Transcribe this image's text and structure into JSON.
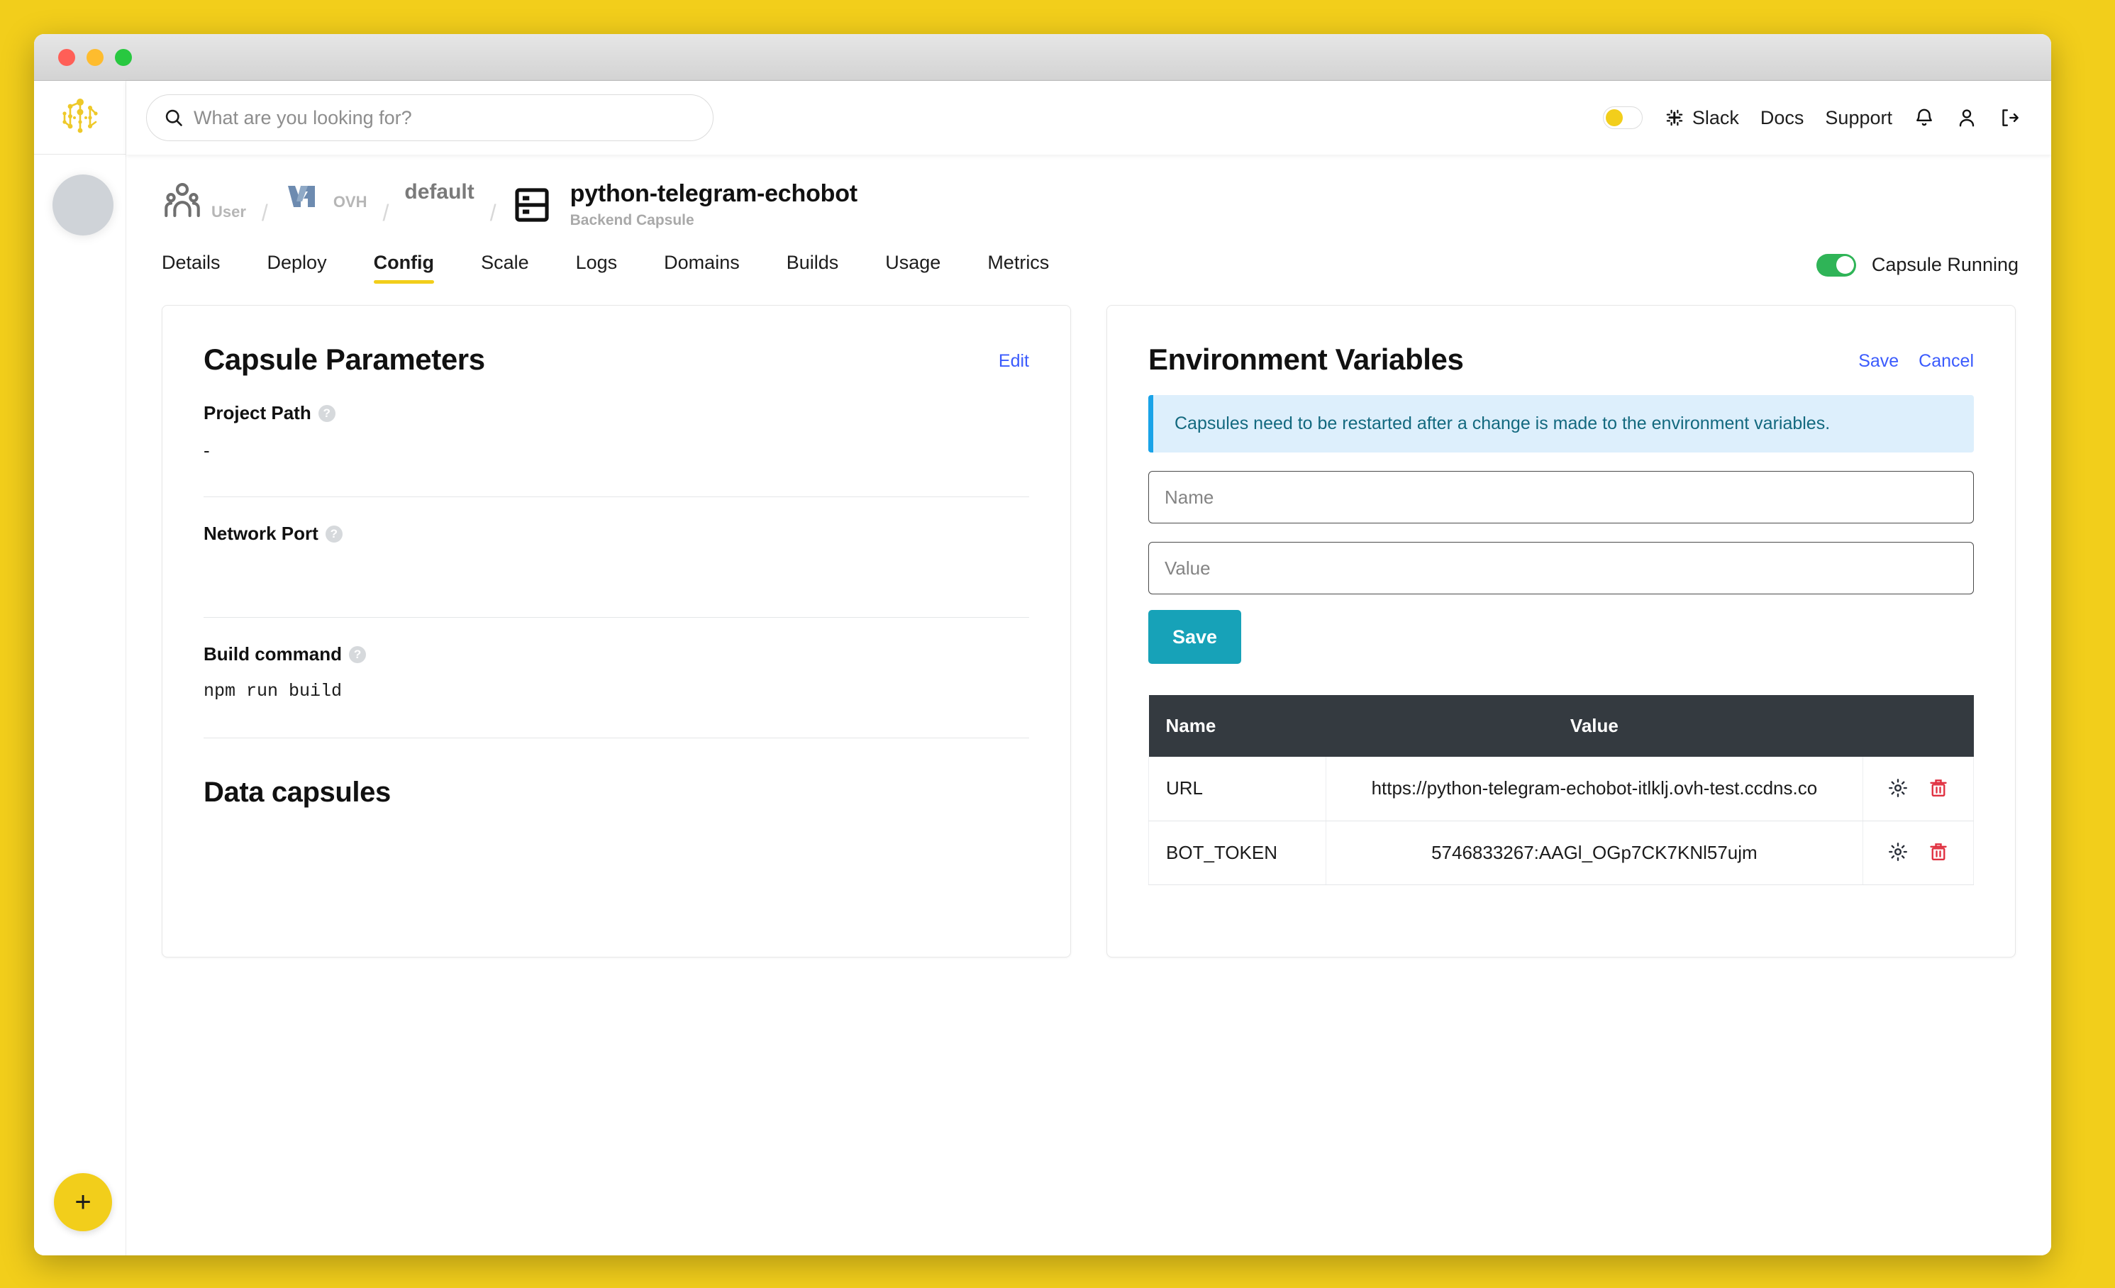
{
  "window": {
    "traffic_lights": [
      "close",
      "minimize",
      "zoom"
    ]
  },
  "sidebar": {
    "logo_name": "capsule-network-logo",
    "add_button_label": "+"
  },
  "search": {
    "placeholder": "What are you looking for?",
    "value": "",
    "icon": "search-icon"
  },
  "topbar": {
    "theme_toggle_state": "off",
    "links": [
      {
        "label": "Slack",
        "icon": "slack-icon"
      },
      {
        "label": "Docs",
        "icon": null
      },
      {
        "label": "Support",
        "icon": null
      }
    ],
    "icons": [
      {
        "name": "bell-icon"
      },
      {
        "name": "user-icon"
      },
      {
        "name": "logout-icon"
      }
    ]
  },
  "breadcrumb": {
    "items": [
      {
        "label": "User",
        "icon": "users-icon"
      },
      {
        "label": "OVH",
        "icon": "ovh-logo-icon"
      },
      {
        "label": "default",
        "icon": null
      }
    ],
    "separator": "/",
    "current": {
      "title": "python-telegram-echobot",
      "subtitle": "Backend Capsule",
      "icon": "server-rack-icon"
    }
  },
  "tabs": {
    "items": [
      {
        "label": "Details",
        "active": false
      },
      {
        "label": "Deploy",
        "active": false
      },
      {
        "label": "Config",
        "active": true
      },
      {
        "label": "Scale",
        "active": false
      },
      {
        "label": "Logs",
        "active": false
      },
      {
        "label": "Domains",
        "active": false
      },
      {
        "label": "Builds",
        "active": false
      },
      {
        "label": "Usage",
        "active": false
      },
      {
        "label": "Metrics",
        "active": false
      }
    ],
    "status": {
      "label": "Capsule Running",
      "state": "on",
      "color": "#2fb457"
    }
  },
  "capsule_parameters": {
    "title": "Capsule Parameters",
    "edit_label": "Edit",
    "params": [
      {
        "label": "Project Path",
        "value": "-",
        "help": "?"
      },
      {
        "label": "Network Port",
        "value": "",
        "help": "?"
      },
      {
        "label": "Build command",
        "value": "npm run build",
        "help": "?"
      }
    ],
    "data_capsules_title": "Data capsules"
  },
  "environment_variables": {
    "title": "Environment Variables",
    "save_label": "Save",
    "cancel_label": "Cancel",
    "notice": "Capsules need to be restarted after a change is made to the environment variables.",
    "name_placeholder": "Name",
    "name_value": "",
    "value_placeholder": "Value",
    "value_value": "",
    "save_button_label": "Save",
    "table": {
      "columns": [
        "Name",
        "Value"
      ],
      "rows": [
        {
          "name": "URL",
          "value": "https://python-telegram-echobot-itlklj.ovh-test.ccdns.co",
          "edit_icon": "gear-icon",
          "delete_icon": "trash-icon"
        },
        {
          "name": "BOT_TOKEN",
          "value": "5746833267:AAGl_OGp7CK7KNl57ujm",
          "edit_icon": "gear-icon",
          "delete_icon": "trash-icon"
        }
      ]
    }
  },
  "colors": {
    "brand_yellow": "#F2CE1B",
    "accent_blue": "#3b5bfd",
    "teal": "#17a2b8",
    "green": "#2fb457",
    "danger_red": "#e03040",
    "table_header": "#343a40",
    "notice_bg": "#ddeffc",
    "notice_border": "#1aa3e8"
  }
}
